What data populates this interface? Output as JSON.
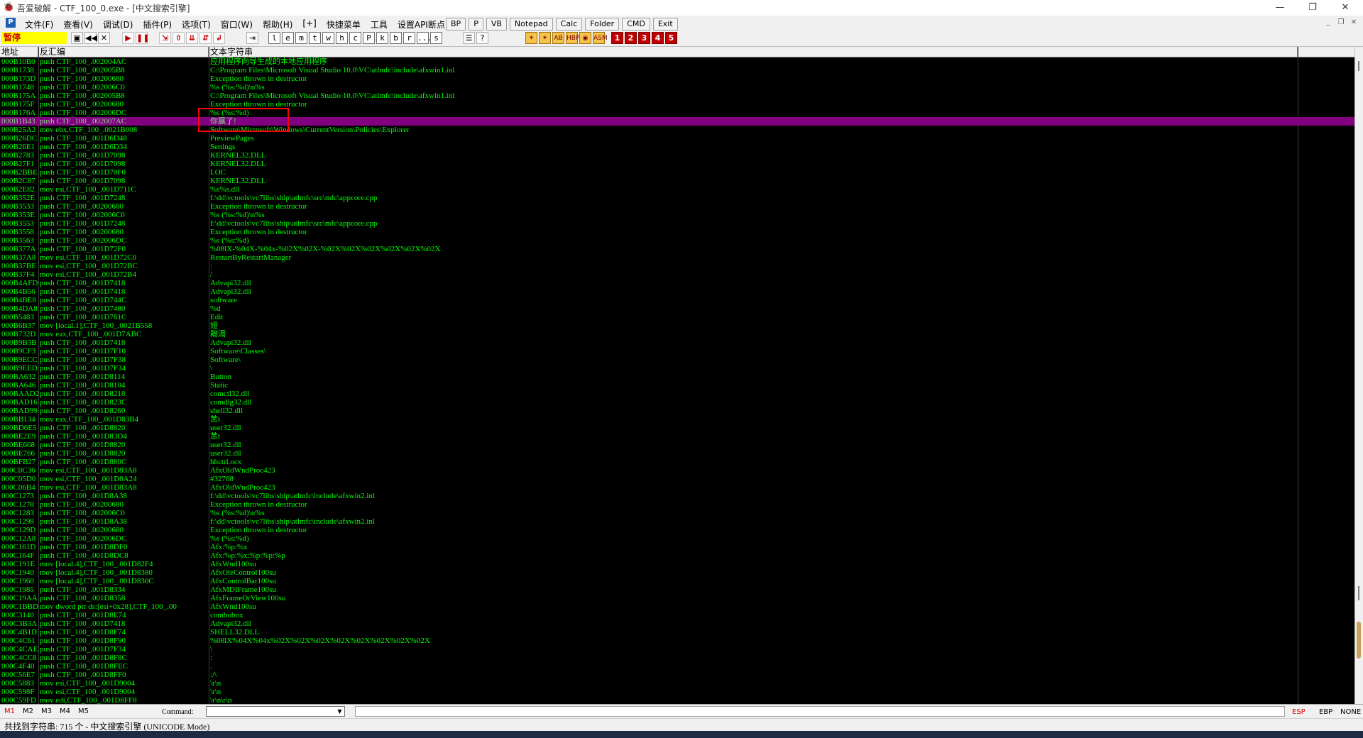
{
  "window": {
    "title": "吾爱破解 - CTF_100_0.exe - [中文搜索引擎]",
    "app_icon": "bug-icon",
    "controls": [
      "—",
      "❐",
      "✕"
    ]
  },
  "menu": {
    "items": [
      "文件(F)",
      "查看(V)",
      "调试(D)",
      "插件(P)",
      "选项(T)",
      "窗口(W)",
      "帮助(H)",
      "[+]",
      "快捷菜单",
      "工具",
      "设置API断点>"
    ],
    "quick_buttons": [
      "BP",
      "P",
      "VB",
      "Notepad",
      "Calc",
      "Folder",
      "CMD",
      "Exit"
    ],
    "mdi_controls": [
      "_",
      "❐",
      "✕"
    ]
  },
  "toolbar": {
    "status": "暂停",
    "file_buttons": [
      "▣",
      "◀◀",
      "✕"
    ],
    "run_buttons": [
      "▶",
      "❚❚"
    ],
    "step_buttons": [
      "⇲",
      "⇳",
      "⇊",
      "⇵",
      "↲"
    ],
    "goto_button": "⇥",
    "letter_buttons": [
      "l",
      "e",
      "m",
      "t",
      "w",
      "h",
      "c",
      "P",
      "k",
      "b",
      "r",
      "...",
      "s"
    ],
    "extra_buttons": [
      "☰",
      "?"
    ],
    "plugin_buttons": [
      "✶",
      "✶",
      "AB",
      "HBP",
      "◉",
      "ASM"
    ],
    "number_buttons": [
      "1",
      "2",
      "3",
      "4",
      "5"
    ]
  },
  "columns": {
    "address": "地址",
    "disassembly": "反汇编",
    "text": "文本字符串"
  },
  "rows": [
    {
      "a": "000B10B0",
      "d": "push CTF_100_.002004AC",
      "t": "应用程序向导生成的本地应用程序"
    },
    {
      "a": "000B1738",
      "d": "push CTF_100_.002005B8",
      "t": "C:\\Program Files\\Microsoft Visual Studio 10.0\\VC\\atlmfc\\include\\afxwin1.inl"
    },
    {
      "a": "000B173D",
      "d": "push CTF_100_.00200680",
      "t": "Exception thrown in destructor"
    },
    {
      "a": "000B1748",
      "d": "push CTF_100_.002006C0",
      "t": "%s (%s:%d)\\n%s"
    },
    {
      "a": "000B175A",
      "d": "push CTF_100_.002005B8",
      "t": "C:\\Program Files\\Microsoft Visual Studio 10.0\\VC\\atlmfc\\include\\afxwin1.inl"
    },
    {
      "a": "000B175F",
      "d": "push CTF_100_.00200680",
      "t": "Exception thrown in destructor"
    },
    {
      "a": "000B176A",
      "d": "push CTF_100_.002006DC",
      "t": "%s (%s:%d)"
    },
    {
      "a": "000B1B43",
      "d": "push CTF_100_.002007AC",
      "t": "你赢了!",
      "sel": true
    },
    {
      "a": "000B25A2",
      "d": "mov ebx,CTF_100_.0021B008",
      "t": "Software\\Microsoft\\Windows\\CurrentVersion\\Policies\\Explorer"
    },
    {
      "a": "000B26DC",
      "d": "push CTF_100_.001D6D48",
      "t": "PreviewPages"
    },
    {
      "a": "000B26E1",
      "d": "push CTF_100_.001D6D34",
      "t": "Settings"
    },
    {
      "a": "000B2783",
      "d": "push CTF_100_.001D7098",
      "t": "KERNEL32.DLL"
    },
    {
      "a": "000B27F1",
      "d": "push CTF_100_.001D7098",
      "t": "KERNEL32.DLL"
    },
    {
      "a": "000B2BBE",
      "d": "push CTF_100_.001D70F0",
      "t": "LOC"
    },
    {
      "a": "000B2C87",
      "d": "push CTF_100_.001D7098",
      "t": "KERNEL32.DLL"
    },
    {
      "a": "000B2E82",
      "d": "mov esi,CTF_100_.001D711C",
      "t": "%s%s.dll"
    },
    {
      "a": "000B352E",
      "d": "push CTF_100_.001D7248",
      "t": "f:\\dd\\vctools\\vc7libs\\ship\\atlmfc\\src\\mfc\\appcore.cpp"
    },
    {
      "a": "000B3533",
      "d": "push CTF_100_.00200680",
      "t": "Exception thrown in destructor"
    },
    {
      "a": "000B353E",
      "d": "push CTF_100_.002006C0",
      "t": "%s (%s:%d)\\n%s"
    },
    {
      "a": "000B3553",
      "d": "push CTF_100_.001D7248",
      "t": "f:\\dd\\vctools\\vc7libs\\ship\\atlmfc\\src\\mfc\\appcore.cpp"
    },
    {
      "a": "000B3558",
      "d": "push CTF_100_.00200680",
      "t": "Exception thrown in destructor"
    },
    {
      "a": "000B3563",
      "d": "push CTF_100_.002006DC",
      "t": "%s (%s:%d)"
    },
    {
      "a": "000B377A",
      "d": "push CTF_100_.001D72F0",
      "t": "%08lX-%04X-%04x-%02X%02X-%02X%02X%02X%02X%02X%02X"
    },
    {
      "a": "000B37A8",
      "d": "mov esi,CTF_100_.001D72C0",
      "t": "RestartByRestartManager"
    },
    {
      "a": "000B37BE",
      "d": "mov esi,CTF_100_.001D72BC",
      "t": ":"
    },
    {
      "a": "000B37F4",
      "d": "mov esi,CTF_100_.001D72B4",
      "t": " /"
    },
    {
      "a": "000B4AFD",
      "d": "push CTF_100_.001D7418",
      "t": "Advapi32.dll"
    },
    {
      "a": "000B4B56",
      "d": "push CTF_100_.001D7418",
      "t": "Advapi32.dll"
    },
    {
      "a": "000B4BE8",
      "d": "push CTF_100_.001D744C",
      "t": "software"
    },
    {
      "a": "000B4DA8",
      "d": "push CTF_100_.001D7480",
      "t": "%d"
    },
    {
      "a": "000B5483",
      "d": "push CTF_100_.001D761C",
      "t": "Edit"
    },
    {
      "a": "000B6B37",
      "d": "mov [local.1],CTF_100_.0021B558",
      "t": "娅"
    },
    {
      "a": "000B732D",
      "d": "mov eax,CTF_100_.001D7ABC",
      "t": "鞩滆"
    },
    {
      "a": "000B9B3B",
      "d": "push CTF_100_.001D7418",
      "t": "Advapi32.dll"
    },
    {
      "a": "000B9CF3",
      "d": "push CTF_100_.001D7F10",
      "t": "Software\\Classes\\"
    },
    {
      "a": "000B9ECC",
      "d": "push CTF_100_.001D7F38",
      "t": "Software\\"
    },
    {
      "a": "000B9EED",
      "d": "push CTF_100_.001D7F34",
      "t": "\\"
    },
    {
      "a": "000BA632",
      "d": "push CTF_100_.001D8114",
      "t": "Button"
    },
    {
      "a": "000BA646",
      "d": "push CTF_100_.001D8104",
      "t": "Static"
    },
    {
      "a": "000BAAD2",
      "d": "push CTF_100_.001D8218",
      "t": "comctl32.dll"
    },
    {
      "a": "000BAD16",
      "d": "push CTF_100_.001D823C",
      "t": "comdlg32.dll"
    },
    {
      "a": "000BAD99",
      "d": "push CTF_100_.001D8260",
      "t": "shell32.dll"
    },
    {
      "a": "000BB134",
      "d": "mov eax,CTF_100_.001D83B4",
      "t": "苤t"
    },
    {
      "a": "000BD6E5",
      "d": "push CTF_100_.001D8820",
      "t": "user32.dll"
    },
    {
      "a": "000BE2E9",
      "d": "push CTF_100_.001D83D4",
      "t": "苤t"
    },
    {
      "a": "000BE668",
      "d": "push CTF_100_.001D8820",
      "t": "user32.dll"
    },
    {
      "a": "000BE766",
      "d": "push CTF_100_.001D8820",
      "t": "user32.dll"
    },
    {
      "a": "000BFB27",
      "d": "push CTF_100_.001D880C",
      "t": "hhctrl.ocx"
    },
    {
      "a": "000C0C36",
      "d": "mov esi,CTF_100_.001D83A8",
      "t": "AfxOldWndProc423"
    },
    {
      "a": "000C05D0",
      "d": "mov esi,CTF_100_.001D8A24",
      "t": "#32768"
    },
    {
      "a": "000C06B4",
      "d": "mov esi,CTF_100_.001D83A8",
      "t": "AfxOldWndProc423"
    },
    {
      "a": "000C1273",
      "d": "push CTF_100_.001D8A38",
      "t": "f:\\dd\\vctools\\vc7libs\\ship\\atlmfc\\include\\afxwin2.inl"
    },
    {
      "a": "000C1278",
      "d": "push CTF_100_.00200680",
      "t": "Exception thrown in destructor"
    },
    {
      "a": "000C1283",
      "d": "push CTF_100_.002006C0",
      "t": "%s (%s:%d)\\n%s"
    },
    {
      "a": "000C1298",
      "d": "push CTF_100_.001D8A38",
      "t": "f:\\dd\\vctools\\vc7libs\\ship\\atlmfc\\include\\afxwin2.inl"
    },
    {
      "a": "000C129D",
      "d": "push CTF_100_.00200680",
      "t": "Exception thrown in destructor"
    },
    {
      "a": "000C12A8",
      "d": "push CTF_100_.002006DC",
      "t": "%s (%s:%d)"
    },
    {
      "a": "000C161D",
      "d": "push CTF_100_.001D8DF0",
      "t": "Afx:%p:%x"
    },
    {
      "a": "000C164F",
      "d": "push CTF_100_.001D8DC8",
      "t": "Afx:%p:%x:%p:%p:%p"
    },
    {
      "a": "000C191E",
      "d": "mov [local.4],CTF_100_.001D82F4",
      "t": "AfxWnd100su"
    },
    {
      "a": "000C1940",
      "d": "mov [local.4],CTF_100_.001D8380",
      "t": "AfxOleControl100su"
    },
    {
      "a": "000C1960",
      "d": "mov [local.4],CTF_100_.001D830C",
      "t": "AfxControlBar100su"
    },
    {
      "a": "000C1985",
      "d": "push CTF_100_.001D8334",
      "t": "AfxMDIFrame100su"
    },
    {
      "a": "000C19AA",
      "d": "push CTF_100_.001D8358",
      "t": "AfxFrameOrView100su"
    },
    {
      "a": "000C1BBD",
      "d": "mov dword ptr ds:[esi+0x28],CTF_100_.00",
      "t": "AfxWnd100su"
    },
    {
      "a": "000C3140",
      "d": "push CTF_100_.001D8E74",
      "t": "combobox"
    },
    {
      "a": "000C3B3A",
      "d": "push CTF_100_.001D7418",
      "t": "Advapi32.dll"
    },
    {
      "a": "000C4B1D",
      "d": "push CTF_100_.001D8F74",
      "t": "SHELL32.DLL"
    },
    {
      "a": "000C4C61",
      "d": "push CTF_100_.001D8F90",
      "t": "%08lX%04X%04x%02X%02X%02X%02X%02X%02X%02X%02X"
    },
    {
      "a": "000C4CAE",
      "d": "push CTF_100_.001D7F34",
      "t": "\\"
    },
    {
      "a": "000C4CC8",
      "d": "push CTF_100_.001D8F8C",
      "t": ":"
    },
    {
      "a": "000C4F40",
      "d": "push CTF_100_.001D8FEC",
      "t": "."
    },
    {
      "a": "000C56E7",
      "d": "push CTF_100_.001D8FF0",
      "t": ":/\\"
    },
    {
      "a": "000C5883",
      "d": "mov esi,CTF_100_.001D9004",
      "t": "\\r\\n"
    },
    {
      "a": "000C598F",
      "d": "mov esi,CTF_100_.001D9004",
      "t": "\\r\\n"
    },
    {
      "a": "000C59FD",
      "d": "mov edi,CTF_100_.001D8FF8",
      "t": "\\r\\n\\r\\n"
    }
  ],
  "command_bar": {
    "tabs": [
      "M1",
      "M2",
      "M3",
      "M4",
      "M5"
    ],
    "label": "Command:",
    "value": "",
    "registers": [
      "ESP",
      "EBP",
      "NONE"
    ]
  },
  "status_bar": {
    "text": "共找到字符串: 715 个  -  中文搜索引擎 (UNICODE Mode)"
  },
  "colors": {
    "panel_bg": "#000000",
    "text_green": "#00ff00",
    "selected_row": "#800080",
    "highlight_box": "#ff0000",
    "pause_bg": "#ffff00"
  }
}
